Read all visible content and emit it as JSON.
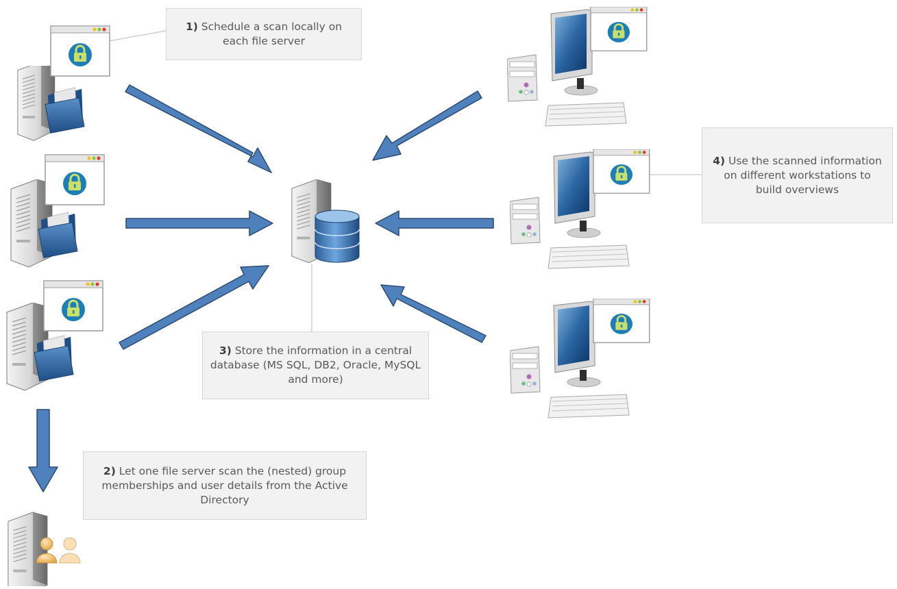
{
  "callouts": [
    {
      "num": "1)",
      "text": "Schedule  a scan locally on each file server"
    },
    {
      "num": "2)",
      "text": "Let one file server scan the (nested) group memberships and user details from the Active Directory"
    },
    {
      "num": "3)",
      "text": "Store the information in a central database (MS SQL, DB2, Oracle, MySQL  and more)"
    },
    {
      "num": "4)",
      "text": "Use the scanned information on different workstations to build overviews"
    }
  ],
  "icons": {
    "file_server": "file-server-icon",
    "database_server": "database-server-icon",
    "workstation": "workstation-icon",
    "ad_server": "active-directory-server-icon",
    "lock": "lock-icon"
  },
  "colors": {
    "arrow_fill": "#4f81bd",
    "arrow_stroke": "#2b4a70",
    "callout_bg": "#f2f2f2",
    "callout_text": "#595959"
  }
}
